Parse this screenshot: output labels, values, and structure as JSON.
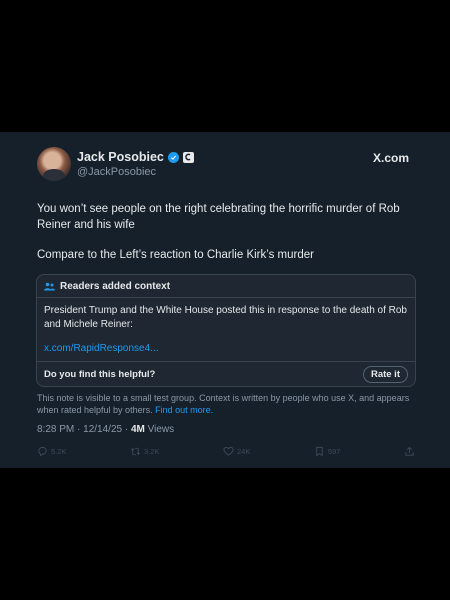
{
  "author": {
    "display_name": "Jack Posobiec",
    "handle": "@JackPosobiec",
    "verified_icon": "verified-badge-icon",
    "org_icon": "org-badge-icon"
  },
  "watermark": "X.com",
  "tweet": {
    "paragraph_1": "You won’t see people on the right celebrating the horrific murder of Rob Reiner and his wife",
    "paragraph_2": "Compare to the Left’s reaction to Charlie Kirk’s murder"
  },
  "community_note": {
    "header": "Readers added context",
    "body": "President Trump and the White House posted this in response to the death of Rob and Michele Reiner:",
    "link": "x.com/RapidResponse4...",
    "question": "Do you find this helpful?",
    "rate_label": "Rate it",
    "disclaimer": "This note is visible to a small test group. Context is written by people who use X, and appears when rated helpful by others.",
    "find_out_more": "Find out more."
  },
  "meta": {
    "time": "8:28 PM",
    "separator_1": " · ",
    "date": "12/14/25",
    "separator_2": " · ",
    "views_count": "4M",
    "views_label": " Views"
  },
  "actions": {
    "replies": "5.2K",
    "reposts": "3.2K",
    "likes": "24K",
    "bookmarks": "597"
  },
  "colors": {
    "background": "#15202b",
    "accent": "#1d9bf0",
    "muted": "#8b98a5"
  }
}
